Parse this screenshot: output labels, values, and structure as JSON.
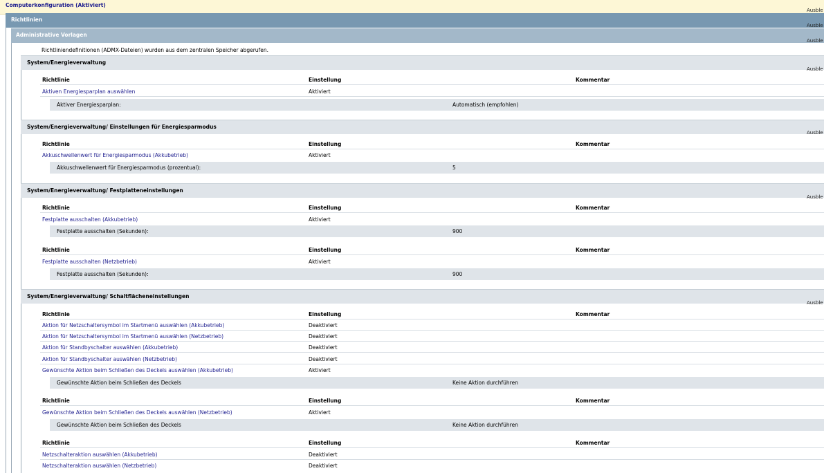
{
  "header": {
    "title": "Computerkonfiguration (Aktiviert)",
    "toggle": "Ausble"
  },
  "richtlinien": {
    "label": "Richtlinien",
    "toggle": "Ausble"
  },
  "admin_templates": {
    "label": "Administrative Vorlagen",
    "toggle": "Ausble",
    "note": "Richtliniendefinitionen (ADMX-Dateien) wurden aus dem zentralen Speicher abgerufen."
  },
  "columns": {
    "policy": "Richtlinie",
    "setting": "Einstellung",
    "comment": "Kommentar"
  },
  "sections": [
    {
      "title": "System/Energieverwaltung",
      "toggle": "Ausble",
      "groups": [
        {
          "rows": [
            {
              "policy": "Aktiven Energiesparplan auswählen",
              "setting": "Aktiviert"
            }
          ],
          "details": [
            {
              "label": "Aktiver Energiesparplan:",
              "value": "Automatisch (empfohlen)"
            }
          ]
        }
      ]
    },
    {
      "title": "System/Energieverwaltung/ Einstellungen für Energiesparmodus",
      "toggle": "Ausble",
      "groups": [
        {
          "rows": [
            {
              "policy": "Akkuschwellenwert für Energiesparmodus (Akkubetrieb)",
              "setting": "Aktiviert"
            }
          ],
          "details": [
            {
              "label": "Akkuschwellenwert für Energiesparmodus (prozentual):",
              "value": "5"
            }
          ]
        }
      ]
    },
    {
      "title": "System/Energieverwaltung/ Festplatteneinstellungen",
      "toggle": "Ausble",
      "groups": [
        {
          "rows": [
            {
              "policy": "Festplatte ausschalten (Akkubetrieb)",
              "setting": "Aktiviert"
            }
          ],
          "details": [
            {
              "label": "Festplatte ausschalten (Sekunden):",
              "value": "900"
            }
          ]
        },
        {
          "rows": [
            {
              "policy": "Festplatte ausschalten (Netzbetrieb)",
              "setting": "Aktiviert"
            }
          ],
          "details": [
            {
              "label": "Festplatte ausschalten (Sekunden):",
              "value": "900"
            }
          ]
        }
      ]
    },
    {
      "title": "System/Energieverwaltung/ Schaltflächeneinstellungen",
      "toggle": "Ausble",
      "groups": [
        {
          "rows": [
            {
              "policy": "Aktion für Netzschaltersymbol im Startmenü auswählen (Akkubetrieb)",
              "setting": "Deaktiviert"
            },
            {
              "policy": "Aktion für Netzschaltersymbol im Startmenü auswählen (Netzbetrieb)",
              "setting": "Deaktiviert"
            },
            {
              "policy": "Aktion für Standbyschalter auswählen (Akkubetrieb)",
              "setting": "Deaktiviert"
            },
            {
              "policy": "Aktion für Standbyschalter auswählen (Netzbetrieb)",
              "setting": "Deaktiviert"
            },
            {
              "policy": "Gewünschte Aktion beim Schließen des Deckels auswählen (Akkubetrieb)",
              "setting": "Aktiviert"
            }
          ],
          "details": [
            {
              "label": "Gewünschte Aktion beim Schließen des Deckels",
              "value": "Keine Aktion durchführen"
            }
          ]
        },
        {
          "rows": [
            {
              "policy": "Gewünschte Aktion beim Schließen des Deckels auswählen (Netzbetrieb)",
              "setting": "Aktiviert"
            }
          ],
          "details": [
            {
              "label": "Gewünschte Aktion beim Schließen des Deckels",
              "value": "Keine Aktion durchführen"
            }
          ]
        },
        {
          "rows": [
            {
              "policy": "Netzschalteraktion auswählen (Akkubetrieb)",
              "setting": "Deaktiviert"
            },
            {
              "policy": "Netzschalteraktion auswählen (Netzbetrieb)",
              "setting": "Deaktiviert"
            }
          ],
          "details": []
        }
      ]
    }
  ]
}
